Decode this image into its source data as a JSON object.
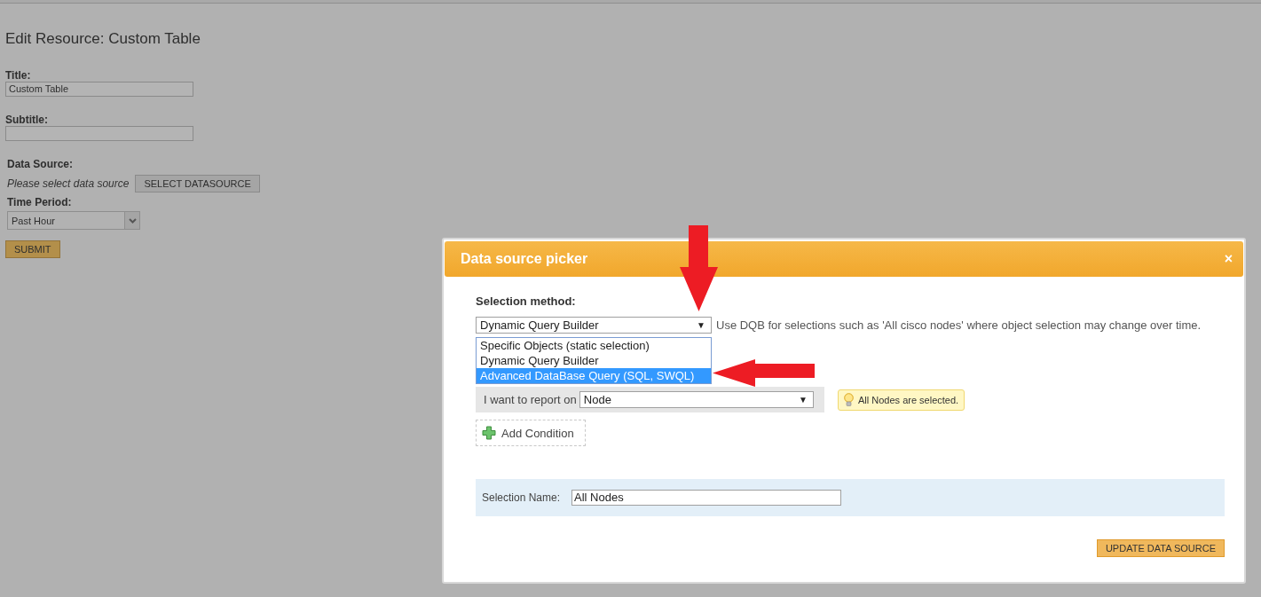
{
  "page": {
    "title": "Edit Resource: Custom Table",
    "fields": [
      {
        "label": "Title:",
        "value": "Custom Table"
      },
      {
        "label": "Subtitle:"
      }
    ],
    "data_source": {
      "label": "Data Source:",
      "hint": "Please select data source",
      "button": "SELECT DATASOURCE"
    },
    "time_period": {
      "label": "Time Period:",
      "value": "Past Hour"
    },
    "submit": "SUBMIT"
  },
  "dialog": {
    "title": "Data source picker",
    "close": "×",
    "selection_method": {
      "label": "Selection method:",
      "value": "Dynamic Query Builder",
      "caret": "▼",
      "hint": "Use DQB for selections such as 'All cisco nodes' where object selection may change over time.",
      "options": [
        {
          "label": "Specific Objects (static selection)",
          "highlighted": false
        },
        {
          "label": "Dynamic Query Builder",
          "highlighted": false
        },
        {
          "label": "Advanced DataBase Query (SQL, SWQL)",
          "highlighted": true
        }
      ]
    },
    "report_on": {
      "label": "I want to report on",
      "value": "Node",
      "caret": "▼"
    },
    "tip": "All Nodes are selected.",
    "add_condition": "Add Condition",
    "selection_name": {
      "label": "Selection Name:",
      "value": "All Nodes"
    },
    "update_button": "UPDATE DATA SOURCE"
  }
}
